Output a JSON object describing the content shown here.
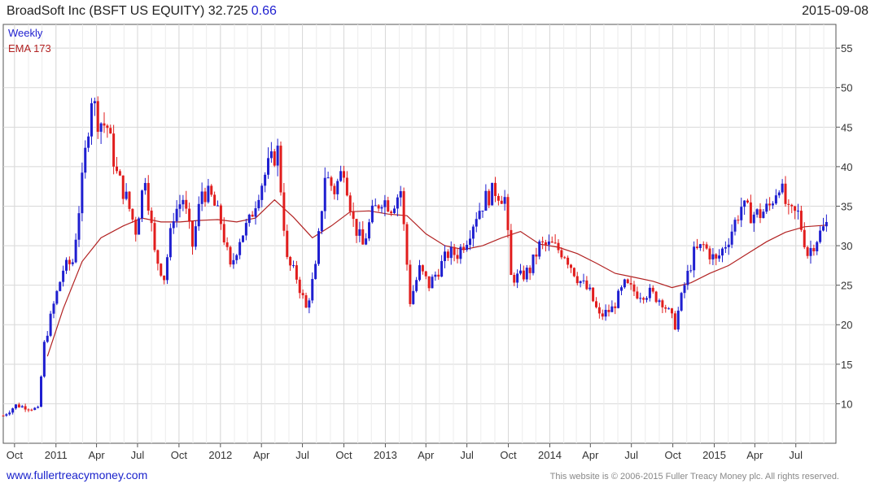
{
  "header": {
    "title_name": "BroadSoft Inc (BSFT US EQUITY)",
    "last_price": "32.725",
    "change": "0.66",
    "date": "2015-09-08"
  },
  "legend": {
    "weekly": "Weekly",
    "ema": "EMA 173"
  },
  "footer": {
    "site": "www.fullertreacymoney.com",
    "copyright": "This website is © 2006-2015 Fuller Treacy Money plc. All rights reserved."
  },
  "colors": {
    "up": "#1f1fd0",
    "down": "#e11d1d",
    "ema": "#b22222",
    "grid": "#d8d8d8"
  },
  "chart_data": {
    "type": "candlestick",
    "interval": "weekly",
    "ylim": [
      5,
      58
    ],
    "y_ticks": [
      10,
      15,
      20,
      25,
      30,
      35,
      40,
      45,
      50,
      55
    ],
    "x_ticks": [
      "Oct",
      "2011",
      "Apr",
      "Jul",
      "Oct",
      "2012",
      "Apr",
      "Jul",
      "Oct",
      "2013",
      "Apr",
      "Jul",
      "Oct",
      "2014",
      "Apr",
      "Jul",
      "Oct",
      "2015",
      "Apr",
      "Jul"
    ],
    "grid": true,
    "x_range": [
      "2010-09-06",
      "2015-09-28"
    ],
    "series": [
      {
        "name": "Weekly",
        "style": "candles",
        "close_points": [
          [
            "2010-09-06",
            8.5
          ],
          [
            "2010-10-04",
            9.8
          ],
          [
            "2010-11-01",
            9.5
          ],
          [
            "2010-11-22",
            9.3
          ],
          [
            "2010-12-06",
            17.5
          ],
          [
            "2010-12-27",
            22.5
          ],
          [
            "2011-01-17",
            27.0
          ],
          [
            "2011-02-07",
            28.0
          ],
          [
            "2011-02-28",
            38.0
          ],
          [
            "2011-03-21",
            49.0
          ],
          [
            "2011-04-04",
            46.0
          ],
          [
            "2011-04-25",
            45.0
          ],
          [
            "2011-05-16",
            39.0
          ],
          [
            "2011-06-06",
            36.0
          ],
          [
            "2011-06-27",
            32.0
          ],
          [
            "2011-07-18",
            39.0
          ],
          [
            "2011-08-08",
            29.0
          ],
          [
            "2011-08-29",
            26.0
          ],
          [
            "2011-09-19",
            34.0
          ],
          [
            "2011-10-10",
            36.0
          ],
          [
            "2011-10-31",
            30.0
          ],
          [
            "2011-11-21",
            37.0
          ],
          [
            "2011-12-12",
            36.0
          ],
          [
            "2012-01-02",
            33.0
          ],
          [
            "2012-01-23",
            27.0
          ],
          [
            "2012-02-13",
            31.0
          ],
          [
            "2012-03-05",
            33.0
          ],
          [
            "2012-03-26",
            37.0
          ],
          [
            "2012-04-16",
            40.0
          ],
          [
            "2012-05-07",
            42.0
          ],
          [
            "2012-05-28",
            28.0
          ],
          [
            "2012-06-18",
            26.0
          ],
          [
            "2012-07-09",
            22.0
          ],
          [
            "2012-07-30",
            27.0
          ],
          [
            "2012-08-20",
            39.0
          ],
          [
            "2012-09-10",
            37.0
          ],
          [
            "2012-10-01",
            40.0
          ],
          [
            "2012-10-22",
            33.0
          ],
          [
            "2012-11-12",
            30.0
          ],
          [
            "2012-12-03",
            34.0
          ],
          [
            "2012-12-24",
            36.0
          ],
          [
            "2013-01-14",
            35.0
          ],
          [
            "2013-02-04",
            37.0
          ],
          [
            "2013-02-25",
            23.0
          ],
          [
            "2013-03-18",
            27.0
          ],
          [
            "2013-04-08",
            25.0
          ],
          [
            "2013-04-29",
            27.0
          ],
          [
            "2013-05-20",
            29.0
          ],
          [
            "2013-06-10",
            29.0
          ],
          [
            "2013-07-01",
            31.0
          ],
          [
            "2013-07-22",
            34.0
          ],
          [
            "2013-08-12",
            36.0
          ],
          [
            "2013-09-02",
            37.0
          ],
          [
            "2013-09-23",
            36.0
          ],
          [
            "2013-10-07",
            26.0
          ],
          [
            "2013-10-28",
            26.0
          ],
          [
            "2013-11-18",
            27.0
          ],
          [
            "2013-12-09",
            30.0
          ],
          [
            "2014-01-06",
            30.0
          ],
          [
            "2014-02-03",
            29.0
          ],
          [
            "2014-03-03",
            26.0
          ],
          [
            "2014-03-31",
            24.0
          ],
          [
            "2014-04-21",
            21.0
          ],
          [
            "2014-05-19",
            22.0
          ],
          [
            "2014-06-16",
            25.0
          ],
          [
            "2014-07-14",
            24.0
          ],
          [
            "2014-08-11",
            24.0
          ],
          [
            "2014-09-08",
            23.0
          ],
          [
            "2014-10-06",
            20.0
          ],
          [
            "2014-10-27",
            25.0
          ],
          [
            "2014-11-17",
            29.0
          ],
          [
            "2014-12-08",
            30.0
          ],
          [
            "2015-01-05",
            28.0
          ],
          [
            "2015-02-02",
            31.0
          ],
          [
            "2015-03-02",
            35.0
          ],
          [
            "2015-03-23",
            34.0
          ],
          [
            "2015-04-13",
            34.0
          ],
          [
            "2015-05-04",
            35.0
          ],
          [
            "2015-05-25",
            38.0
          ],
          [
            "2015-06-15",
            34.0
          ],
          [
            "2015-07-06",
            34.0
          ],
          [
            "2015-07-27",
            29.0
          ],
          [
            "2015-08-17",
            31.0
          ],
          [
            "2015-09-07",
            32.7
          ]
        ]
      },
      {
        "name": "EMA 173",
        "style": "line",
        "points": [
          [
            "2010-12-13",
            16.0
          ],
          [
            "2011-01-17",
            22.0
          ],
          [
            "2011-02-28",
            28.0
          ],
          [
            "2011-04-11",
            31.0
          ],
          [
            "2011-05-30",
            32.5
          ],
          [
            "2011-07-11",
            33.5
          ],
          [
            "2011-08-22",
            33.0
          ],
          [
            "2011-10-03",
            33.0
          ],
          [
            "2011-11-14",
            33.2
          ],
          [
            "2011-12-26",
            33.3
          ],
          [
            "2012-02-06",
            33.0
          ],
          [
            "2012-03-19",
            33.5
          ],
          [
            "2012-04-30",
            35.8
          ],
          [
            "2012-06-11",
            33.6
          ],
          [
            "2012-07-23",
            31.0
          ],
          [
            "2012-09-03",
            32.5
          ],
          [
            "2012-10-15",
            34.3
          ],
          [
            "2012-11-26",
            34.4
          ],
          [
            "2013-01-07",
            34.0
          ],
          [
            "2013-02-18",
            33.8
          ],
          [
            "2013-04-01",
            31.5
          ],
          [
            "2013-05-13",
            30.0
          ],
          [
            "2013-06-24",
            29.5
          ],
          [
            "2013-08-05",
            30.0
          ],
          [
            "2013-09-16",
            31.0
          ],
          [
            "2013-10-28",
            31.8
          ],
          [
            "2013-12-09",
            30.2
          ],
          [
            "2014-01-20",
            29.8
          ],
          [
            "2014-03-03",
            29.0
          ],
          [
            "2014-04-14",
            27.8
          ],
          [
            "2014-05-26",
            26.5
          ],
          [
            "2014-07-07",
            26.0
          ],
          [
            "2014-08-18",
            25.5
          ],
          [
            "2014-09-29",
            24.7
          ],
          [
            "2014-11-10",
            25.3
          ],
          [
            "2014-12-22",
            26.5
          ],
          [
            "2015-02-02",
            27.5
          ],
          [
            "2015-03-16",
            29.0
          ],
          [
            "2015-04-27",
            30.5
          ],
          [
            "2015-06-08",
            31.7
          ],
          [
            "2015-07-20",
            32.4
          ],
          [
            "2015-09-07",
            32.6
          ]
        ]
      }
    ]
  }
}
